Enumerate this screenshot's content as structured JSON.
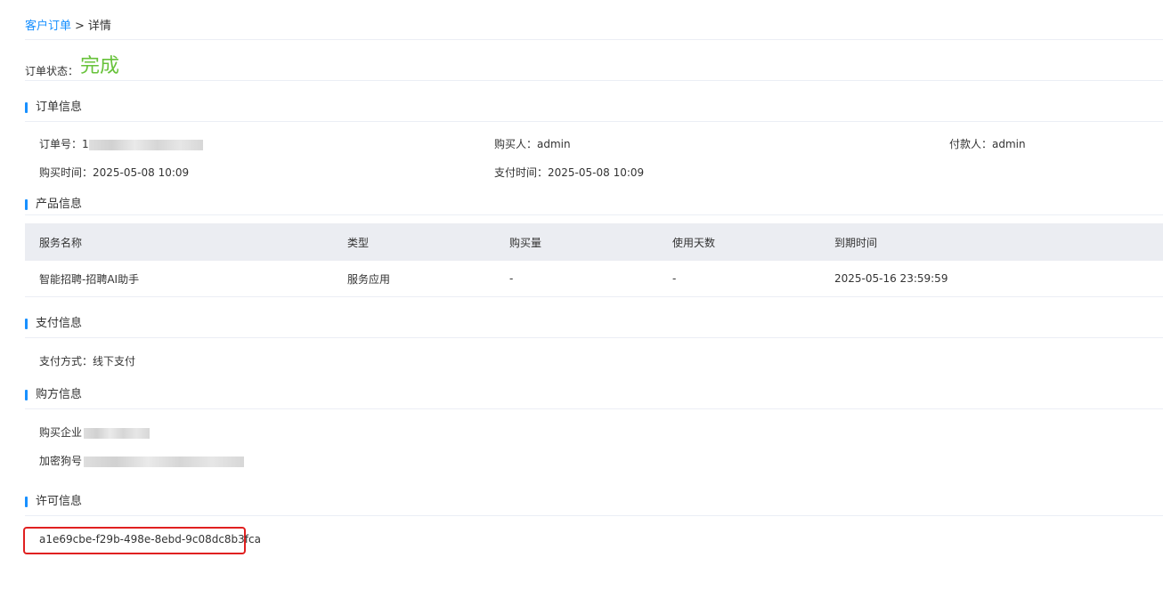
{
  "breadcrumb": {
    "parent": "客户订单",
    "separator": ">",
    "current": "详情"
  },
  "status": {
    "label": "订单状态：",
    "value": "完成",
    "color": "#67c23a"
  },
  "order_info": {
    "title": "订单信息",
    "order_no_label": "订单号：",
    "order_no_value": "1",
    "buyer_label": "购买人：",
    "buyer_value": "admin",
    "payer_label": "付款人：",
    "payer_value": "admin",
    "purchase_time_label": "购买时间：",
    "purchase_time_value": "2025-05-08 10:09",
    "pay_time_label": "支付时间：",
    "pay_time_value": "2025-05-08 10:09"
  },
  "product_info": {
    "title": "产品信息",
    "columns": [
      "服务名称",
      "类型",
      "购买量",
      "使用天数",
      "到期时间"
    ],
    "rows": [
      [
        "智能招聘-招聘AI助手",
        "服务应用",
        "-",
        "-",
        "2025-05-16 23:59:59"
      ]
    ]
  },
  "payment_info": {
    "title": "支付信息",
    "method_label": "支付方式：",
    "method_value": "线下支付"
  },
  "buyer_info": {
    "title": "购方信息",
    "company_label": "购买企业",
    "dongle_label": "加密狗号"
  },
  "license_info": {
    "title": "许可信息",
    "license_key": "a1e69cbe-f29b-498e-8ebd-9c08dc8b3fca",
    "highlight_color": "#e02020"
  },
  "colors": {
    "accent": "#1890ff",
    "success": "#67c23a",
    "table_header_bg": "#ebedf2"
  }
}
